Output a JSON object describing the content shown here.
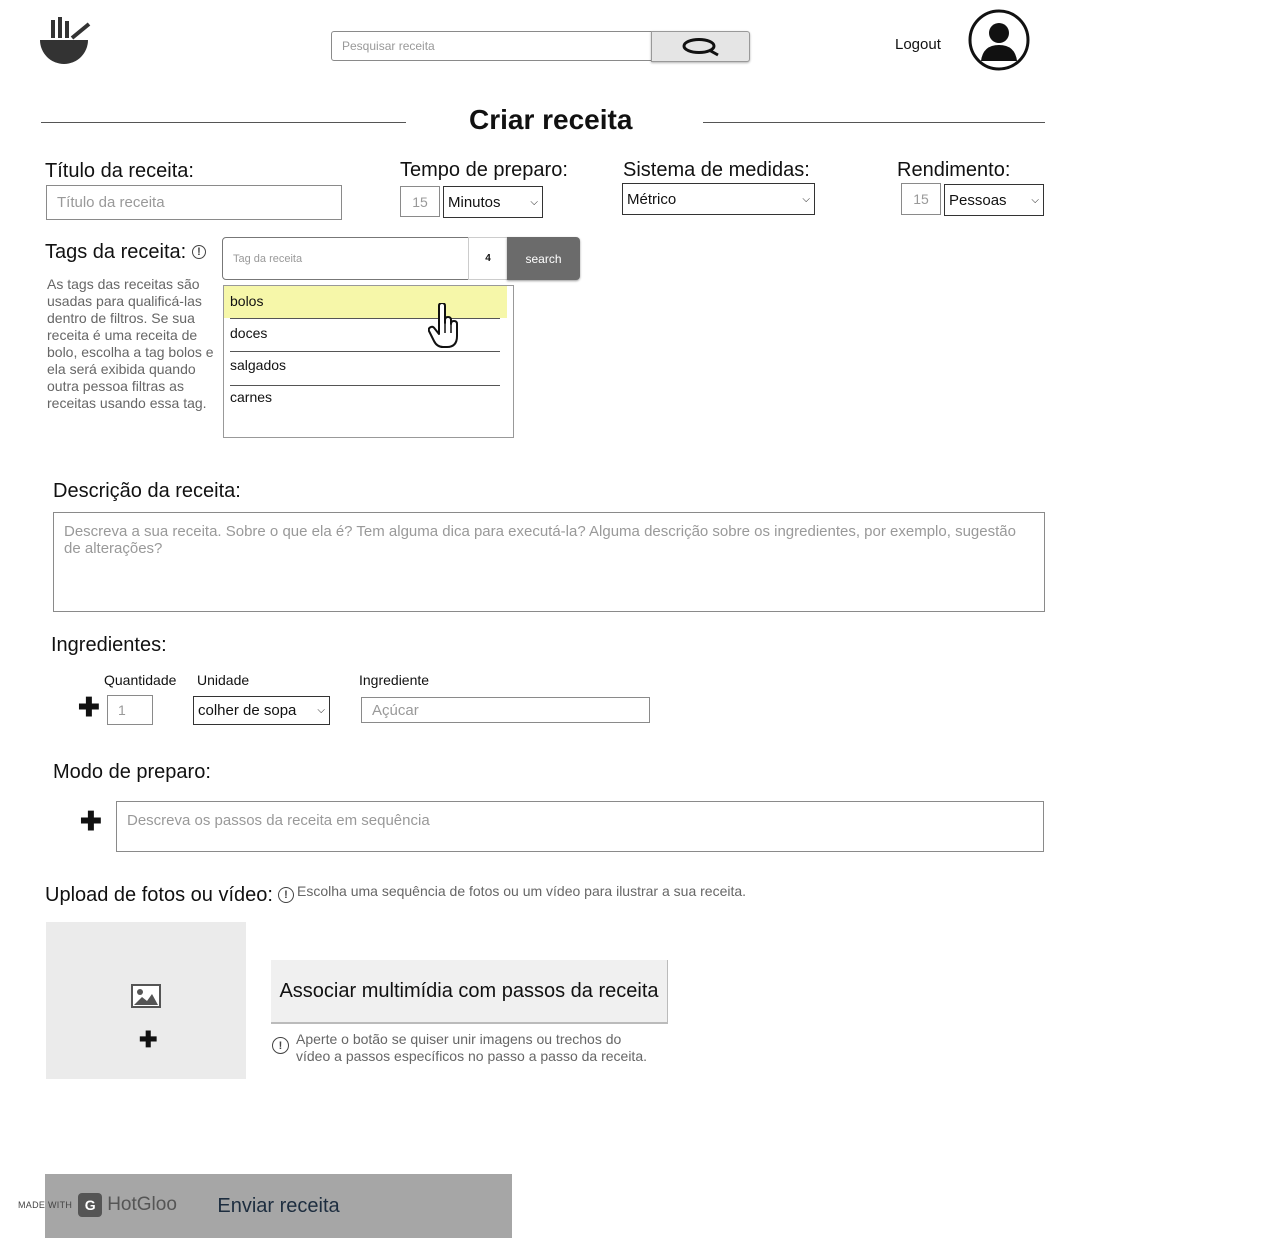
{
  "header": {
    "logo_icon": "bowl-with-chopsticks-icon",
    "search_placeholder": "Pesquisar receita",
    "search_icon": "search-icon",
    "logout_label": "Logout",
    "avatar_icon": "user-avatar-icon"
  },
  "page": {
    "title": "Criar receita"
  },
  "form": {
    "title_label": "Título da receita:",
    "title_placeholder": "Título da receita",
    "prep_time_label": "Tempo de preparo:",
    "prep_time_placeholder": "15",
    "prep_time_unit": "Minutos",
    "measure_label": "Sistema de medidas:",
    "measure_value": "Métrico",
    "yield_label": "Rendimento:",
    "yield_placeholder": "15",
    "yield_unit": "Pessoas",
    "tags_label": "Tags da receita:",
    "tags_hint": "As tags das receitas são usadas para qualificá-las dentro de filtros. Se sua receita é uma receita de bolo, escolha a tag bolos e ela será exibida quando outra pessoa filtras as receitas usando essa tag.",
    "tag_placeholder": "Tag da receita",
    "tag_count": "4",
    "tag_search_label": "search",
    "tag_options": [
      "bolos",
      "doces",
      "salgados",
      "carnes"
    ],
    "highlight_color": "#f6f7a9",
    "description_label": "Descrição da receita:",
    "description_placeholder": "Descreva a sua receita. Sobre o que ela é? Tem alguma dica para executá-la? Alguma descrição sobre os ingredientes, por exemplo, sugestão de alterações?",
    "ingredients_label": "Ingredientes:",
    "qty_header": "Quantidade",
    "unit_header": "Unidade",
    "ingredient_header": "Ingrediente",
    "qty_placeholder": "1",
    "unit_value": "colher de sopa",
    "ingredient_placeholder": "Açúcar",
    "steps_label": "Modo de preparo:",
    "steps_placeholder": "Descreva os passos da receita em sequência",
    "upload_label": "Upload de fotos ou vídeo:",
    "upload_hint": "Escolha uma sequência de fotos ou um vídeo para ilustrar a sua receita.",
    "associate_button": "Associar multimídia com passos da receita",
    "associate_hint": "Aperte o botão se quiser unir imagens ou trechos do vídeo a passos específicos no passo a passo da receita.",
    "submit_label": "Enviar receita"
  },
  "watermark": {
    "made_with": "MADE WITH",
    "brand": "HotGloo"
  }
}
